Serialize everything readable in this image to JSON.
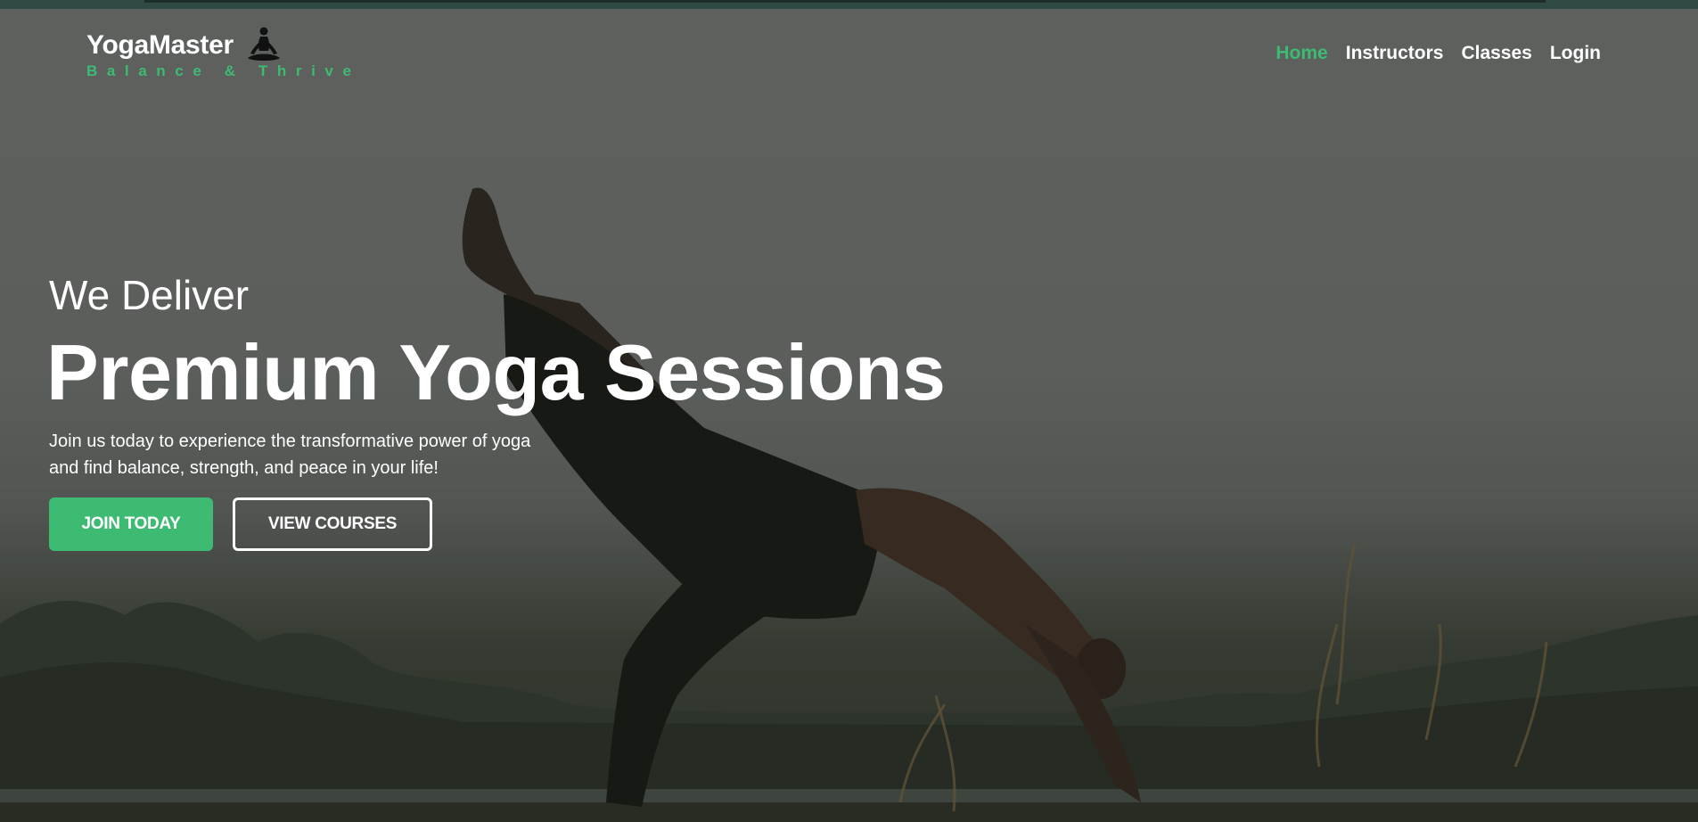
{
  "brand": {
    "name": "YogaMaster",
    "tagline": "Balance & Thrive",
    "logo_icon": "meditating-person-icon"
  },
  "nav": {
    "items": [
      {
        "label": "Home",
        "active": true
      },
      {
        "label": "Instructors",
        "active": false
      },
      {
        "label": "Classes",
        "active": false
      },
      {
        "label": "Login",
        "active": false
      }
    ]
  },
  "hero": {
    "pre_title": "We Deliver",
    "title": "Premium Yoga Sessions",
    "description": "Join us today to experience the transformative power of yoga and find balance, strength, and peace in your life!",
    "primary_button": "JOIN TODAY",
    "secondary_button": "VIEW COURSES"
  },
  "colors": {
    "accent": "#3dbb73",
    "text": "#ffffff",
    "top_strip": "#2f4a44"
  }
}
